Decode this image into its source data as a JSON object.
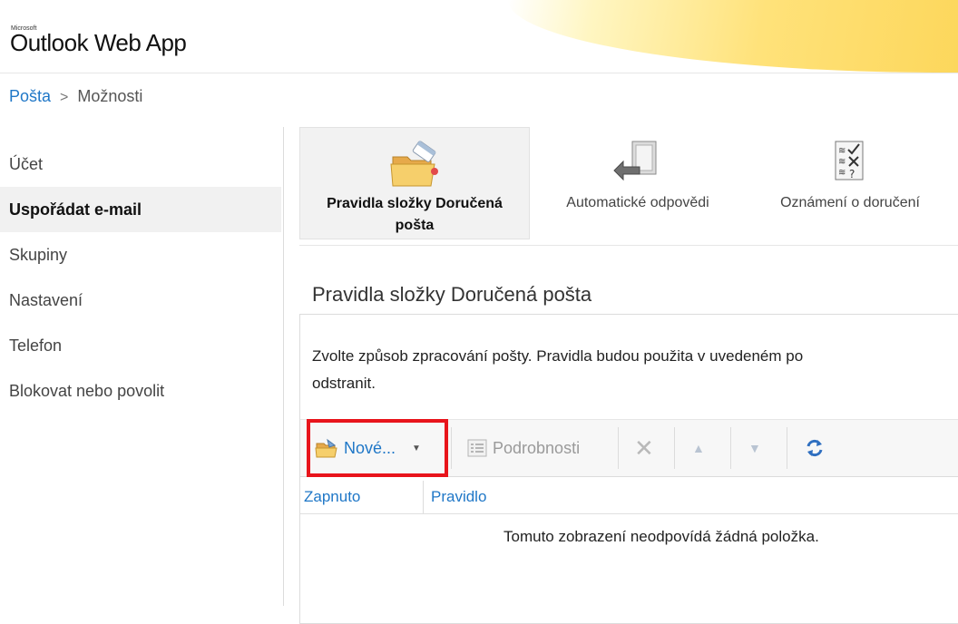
{
  "header": {
    "brand_small": "Microsoft",
    "app_title": "Outlook Web App"
  },
  "breadcrumb": {
    "link": "Pošta",
    "separator": ">",
    "current": "Možnosti"
  },
  "sidebar": {
    "items": [
      {
        "label": "Účet",
        "active": false
      },
      {
        "label": "Uspořádat e-mail",
        "active": true
      },
      {
        "label": "Skupiny",
        "active": false
      },
      {
        "label": "Nastavení",
        "active": false
      },
      {
        "label": "Telefon",
        "active": false
      },
      {
        "label": "Blokovat nebo povolit",
        "active": false
      }
    ]
  },
  "toolbar": {
    "inbox_rules_line1": "Pravidla složky Doručená",
    "inbox_rules_line2": "pošta",
    "auto_replies": "Automatické odpovědi",
    "delivery_reports": "Oznámení o doručení"
  },
  "section": {
    "title": "Pravidla složky Doručená pošta",
    "description_line1": "Zvolte způsob zpracování pošty. Pravidla budou použita v uvedeném po",
    "description_line2": "odstranit."
  },
  "rules_toolbar": {
    "new_label": "Nové...",
    "details_label": "Podrobnosti",
    "new_icon": "folder-new-icon",
    "details_icon": "details-icon",
    "delete_icon": "delete-icon",
    "up_icon": "arrow-up-icon",
    "down_icon": "arrow-down-icon",
    "refresh_icon": "refresh-icon"
  },
  "table": {
    "columns": [
      "Zapnuto",
      "Pravidlo"
    ],
    "empty_message": "Tomuto zobrazení neodpovídá žádná položka."
  },
  "colors": {
    "link": "#1f77c7",
    "highlight": "#e8141b",
    "accent": "#fbd14b"
  }
}
